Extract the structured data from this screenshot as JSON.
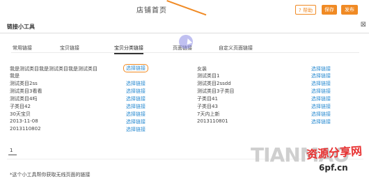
{
  "header": {
    "title": "店铺首页",
    "help_label": "帮助",
    "save_label": "保存",
    "publish_label": "发布"
  },
  "dialog": {
    "title": "链接小工具",
    "close_glyph": "⊠"
  },
  "tabs": [
    {
      "label": "常用链接",
      "active": false
    },
    {
      "label": "宝贝链接",
      "active": false
    },
    {
      "label": "宝贝分类链接",
      "active": true
    },
    {
      "label": "页面链接",
      "active": false
    },
    {
      "label": "自定义页面链接",
      "active": false
    }
  ],
  "left_rows": [
    {
      "name": "我是测试类目我是测试类目我是测试类目",
      "link": "选择链接",
      "highlighted": true
    },
    {
      "name": "我是",
      "link": ""
    },
    {
      "name": "测试类目2ss",
      "link": "选择链接"
    },
    {
      "name": "测试类目3看看",
      "link": "选择链接"
    },
    {
      "name": "测试类目4吗",
      "link": "选择链接"
    },
    {
      "name": "子类目42",
      "link": "选择链接"
    },
    {
      "name": "30天宝贝",
      "link": "选择链接"
    },
    {
      "name": "2013-11-08",
      "link": "选择链接"
    },
    {
      "name": "2013110802",
      "link": "选择链接"
    }
  ],
  "right_rows": [
    {
      "name": "女装",
      "link": "选择链接"
    },
    {
      "name": "测试类目1",
      "link": "选择链接"
    },
    {
      "name": "测试类目2ssdd",
      "link": "选择链接"
    },
    {
      "name": "测试类目3子类目",
      "link": "选择链接"
    },
    {
      "name": "子类目41",
      "link": "选择链接"
    },
    {
      "name": "子类目43",
      "link": "选择链接"
    },
    {
      "name": "7天内上新",
      "link": "选择链接"
    },
    {
      "name": "2013110801",
      "link": "选择链接"
    }
  ],
  "pagination": {
    "current": "1"
  },
  "footnote": "*这个小工具帮你获取无线页面的链接",
  "watermark": {
    "brand": "TIANMAO",
    "cn": "资源分享网",
    "url": "6pf.cn"
  },
  "colors": {
    "accent": "#f08a24",
    "link": "#2a8bd1"
  }
}
